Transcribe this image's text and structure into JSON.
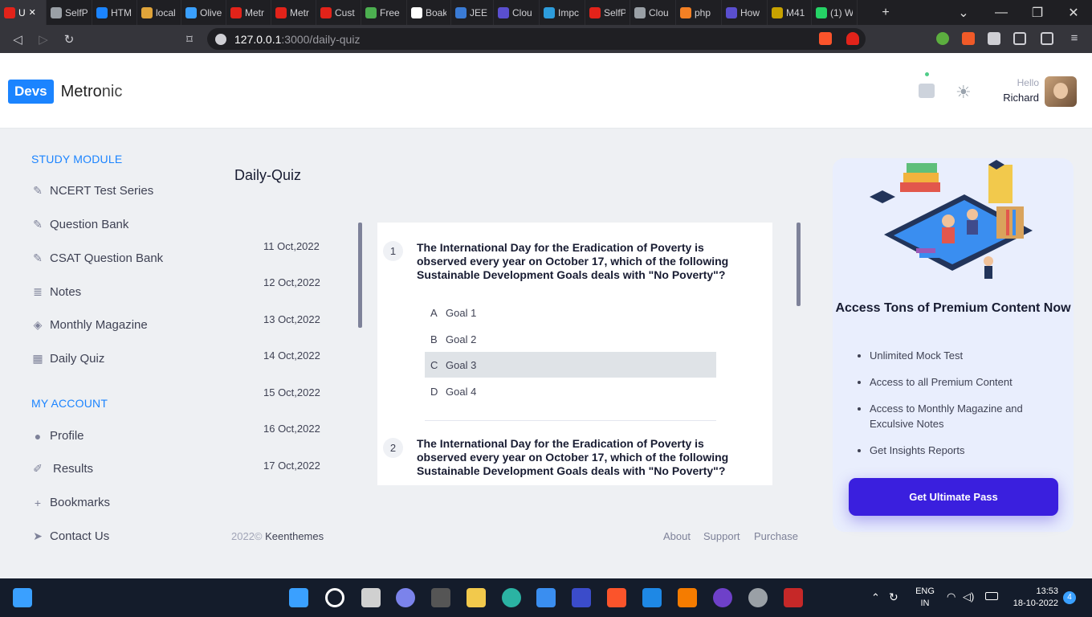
{
  "browser": {
    "tabs": [
      {
        "label": "U",
        "color": "#e2231a",
        "active": true
      },
      {
        "label": "SelfP",
        "color": "#9aa0a6"
      },
      {
        "label": "HTM",
        "color": "#1b84ff"
      },
      {
        "label": "local",
        "color": "#e0a43a"
      },
      {
        "label": "Olive",
        "color": "#3aa0ff"
      },
      {
        "label": "Metr",
        "color": "#e2231a"
      },
      {
        "label": "Metr",
        "color": "#e2231a"
      },
      {
        "label": "Cust",
        "color": "#e2231a"
      },
      {
        "label": "Free",
        "color": "#4caf50"
      },
      {
        "label": "Boak",
        "color": "#ffffff"
      },
      {
        "label": "JEE (",
        "color": "#3a7bd5"
      },
      {
        "label": "Clou",
        "color": "#5a4fcf"
      },
      {
        "label": "Impc",
        "color": "#2d9cdb"
      },
      {
        "label": "SelfP",
        "color": "#e2231a"
      },
      {
        "label": "Clou",
        "color": "#9aa0a6"
      },
      {
        "label": "php",
        "color": "#f48024"
      },
      {
        "label": "How",
        "color": "#5a4fcf"
      },
      {
        "label": "M41",
        "color": "#c8a200"
      },
      {
        "label": "(1) W",
        "color": "#25d366"
      }
    ],
    "new_tab": "+",
    "url_host": "127.0.0.1",
    "url_path": ":3000/daily-quiz"
  },
  "header": {
    "logo_badge": "Devs",
    "logo_brand_a": "Metro",
    "logo_brand_b": "nic",
    "hello": "Hello",
    "user_name": "Richard"
  },
  "sidebar": {
    "study_title": "STUDY MODULE",
    "study_items": [
      "NCERT Test Series",
      "Question Bank",
      "CSAT Question Bank",
      "Notes",
      "Monthly Magazine",
      "Daily Quiz"
    ],
    "account_title": "MY ACCOUNT",
    "account_items": [
      "Profile",
      "Results",
      "Bookmarks",
      "Contact Us"
    ]
  },
  "main": {
    "title": "Daily-Quiz",
    "dates": [
      "11 Oct,2022",
      "12 Oct,2022",
      "13 Oct,2022",
      "14 Oct,2022",
      "15 Oct,2022",
      "16 Oct,2022",
      "17 Oct,2022"
    ],
    "questions": [
      {
        "number": "1",
        "text": "The International Day for the Eradication of Poverty is observed every year on October 17, which of the following Sustainable Development Goals deals with \"No Poverty\"?",
        "options": [
          {
            "letter": "A",
            "text": "Goal 1"
          },
          {
            "letter": "B",
            "text": "Goal 2"
          },
          {
            "letter": "C",
            "text": "Goal 3"
          },
          {
            "letter": "D",
            "text": "Goal 4"
          }
        ],
        "selected": "C"
      },
      {
        "number": "2",
        "text": "The International Day for the Eradication of Poverty is observed every year on October 17, which of the following Sustainable Development Goals deals with \"No Poverty\"?"
      }
    ]
  },
  "footer": {
    "year": "2022©",
    "company": "Keenthemes",
    "links": [
      "About",
      "Support",
      "Purchase"
    ]
  },
  "promo": {
    "title": "Access Tons of Premium Content Now",
    "features": [
      "Unlimited Mock Test",
      "Access to all Premium Content",
      "Access to Monthly Magazine and Exculsive Notes",
      "Get Insights Reports"
    ],
    "cta": "Get Ultimate Pass"
  },
  "taskbar": {
    "lang_top": "ENG",
    "lang_bottom": "IN",
    "time": "13:53",
    "date": "18-10-2022",
    "notifications": "4"
  }
}
